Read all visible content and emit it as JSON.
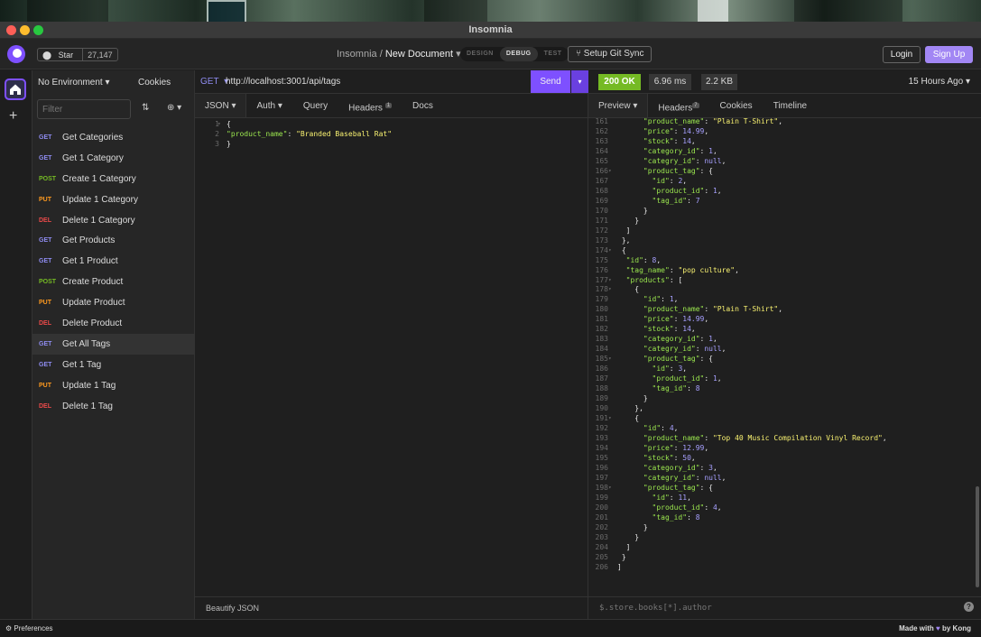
{
  "window": {
    "title": "Insomnia"
  },
  "header": {
    "github_star_label": "Star",
    "github_star_count": "27,147",
    "breadcrumb_root": "Insomnia /",
    "breadcrumb_document": "New Document",
    "modes": [
      "DESIGN",
      "DEBUG",
      "TEST"
    ],
    "active_mode": "DEBUG",
    "git_sync_label": "Setup Git Sync",
    "login_label": "Login",
    "signup_label": "Sign Up"
  },
  "sidebar": {
    "environment": "No Environment",
    "cookies_label": "Cookies",
    "filter_placeholder": "Filter",
    "requests": [
      {
        "method": "GET",
        "name": "Get Categories",
        "color": "#8f8cf1"
      },
      {
        "method": "GET",
        "name": "Get 1 Category",
        "color": "#8f8cf1"
      },
      {
        "method": "POST",
        "name": "Create 1 Category",
        "color": "#75ba24"
      },
      {
        "method": "PUT",
        "name": "Update 1 Category",
        "color": "#ff9a1f"
      },
      {
        "method": "DEL",
        "name": "Delete 1 Category",
        "color": "#ec4a4a"
      },
      {
        "method": "GET",
        "name": "Get Products",
        "color": "#8f8cf1"
      },
      {
        "method": "GET",
        "name": "Get 1 Product",
        "color": "#8f8cf1"
      },
      {
        "method": "POST",
        "name": "Create Product",
        "color": "#75ba24"
      },
      {
        "method": "PUT",
        "name": "Update Product",
        "color": "#ff9a1f"
      },
      {
        "method": "DEL",
        "name": "Delete Product",
        "color": "#ec4a4a"
      },
      {
        "method": "GET",
        "name": "Get All Tags",
        "color": "#8f8cf1",
        "selected": true
      },
      {
        "method": "GET",
        "name": "Get 1 Tag",
        "color": "#8f8cf1"
      },
      {
        "method": "PUT",
        "name": "Update 1 Tag",
        "color": "#ff9a1f"
      },
      {
        "method": "DEL",
        "name": "Delete 1 Tag",
        "color": "#ec4a4a"
      }
    ]
  },
  "request": {
    "method": "GET",
    "url": "http://localhost:3001/api/tags",
    "send_label": "Send",
    "tabs": [
      {
        "label": "JSON",
        "dropdown": true
      },
      {
        "label": "Auth",
        "dropdown": true
      },
      {
        "label": "Query"
      },
      {
        "label": "Headers",
        "badge": "1"
      },
      {
        "label": "Docs"
      }
    ],
    "body_lines": [
      {
        "n": "1",
        "fold": true,
        "parts": [
          [
            "pun",
            "{"
          ]
        ]
      },
      {
        "n": "2",
        "parts": [
          [
            "key",
            "\"product_name\""
          ],
          [
            "pun",
            ": "
          ],
          [
            "str",
            "\"Branded Baseball Rat\""
          ]
        ]
      },
      {
        "n": "3",
        "parts": [
          [
            "pun",
            "}"
          ]
        ]
      }
    ],
    "footer_label": "Beautify JSON"
  },
  "response": {
    "status": "200 OK",
    "time": "6.96 ms",
    "size": "2.2 KB",
    "when": "15 Hours Ago",
    "tabs": [
      {
        "label": "Preview",
        "dropdown": true
      },
      {
        "label": "Headers",
        "badge": "7"
      },
      {
        "label": "Cookies"
      },
      {
        "label": "Timeline"
      }
    ],
    "filter_placeholder": "$.store.books[*].author",
    "body_lines": [
      {
        "n": "161",
        "indent": 6,
        "parts": [
          [
            "key",
            "\"product_name\""
          ],
          [
            "pun",
            ": "
          ],
          [
            "str",
            "\"Plain T-Shirt\""
          ],
          [
            "pun",
            ","
          ]
        ]
      },
      {
        "n": "162",
        "indent": 6,
        "parts": [
          [
            "key",
            "\"price\""
          ],
          [
            "pun",
            ": "
          ],
          [
            "num",
            "14.99"
          ],
          [
            "pun",
            ","
          ]
        ]
      },
      {
        "n": "163",
        "indent": 6,
        "parts": [
          [
            "key",
            "\"stock\""
          ],
          [
            "pun",
            ": "
          ],
          [
            "num",
            "14"
          ],
          [
            "pun",
            ","
          ]
        ]
      },
      {
        "n": "164",
        "indent": 6,
        "parts": [
          [
            "key",
            "\"category_id\""
          ],
          [
            "pun",
            ": "
          ],
          [
            "num",
            "1"
          ],
          [
            "pun",
            ","
          ]
        ]
      },
      {
        "n": "165",
        "indent": 6,
        "parts": [
          [
            "key",
            "\"categry_id\""
          ],
          [
            "pun",
            ": "
          ],
          [
            "nul",
            "null"
          ],
          [
            "pun",
            ","
          ]
        ]
      },
      {
        "n": "166",
        "fold": true,
        "indent": 6,
        "parts": [
          [
            "key",
            "\"product_tag\""
          ],
          [
            "pun",
            ": {"
          ]
        ]
      },
      {
        "n": "167",
        "indent": 8,
        "parts": [
          [
            "key",
            "\"id\""
          ],
          [
            "pun",
            ": "
          ],
          [
            "num",
            "2"
          ],
          [
            "pun",
            ","
          ]
        ]
      },
      {
        "n": "168",
        "indent": 8,
        "parts": [
          [
            "key",
            "\"product_id\""
          ],
          [
            "pun",
            ": "
          ],
          [
            "num",
            "1"
          ],
          [
            "pun",
            ","
          ]
        ]
      },
      {
        "n": "169",
        "indent": 8,
        "parts": [
          [
            "key",
            "\"tag_id\""
          ],
          [
            "pun",
            ": "
          ],
          [
            "num",
            "7"
          ]
        ]
      },
      {
        "n": "170",
        "indent": 6,
        "parts": [
          [
            "pun",
            "}"
          ]
        ]
      },
      {
        "n": "171",
        "indent": 4,
        "parts": [
          [
            "pun",
            "}"
          ]
        ]
      },
      {
        "n": "172",
        "indent": 2,
        "parts": [
          [
            "pun",
            "]"
          ]
        ]
      },
      {
        "n": "173",
        "indent": 1,
        "parts": [
          [
            "pun",
            "},"
          ]
        ]
      },
      {
        "n": "174",
        "fold": true,
        "indent": 1,
        "parts": [
          [
            "pun",
            "{"
          ]
        ]
      },
      {
        "n": "175",
        "indent": 2,
        "parts": [
          [
            "key",
            "\"id\""
          ],
          [
            "pun",
            ": "
          ],
          [
            "num",
            "8"
          ],
          [
            "pun",
            ","
          ]
        ]
      },
      {
        "n": "176",
        "indent": 2,
        "parts": [
          [
            "key",
            "\"tag_name\""
          ],
          [
            "pun",
            ": "
          ],
          [
            "str",
            "\"pop culture\""
          ],
          [
            "pun",
            ","
          ]
        ]
      },
      {
        "n": "177",
        "fold": true,
        "indent": 2,
        "parts": [
          [
            "key",
            "\"products\""
          ],
          [
            "pun",
            ": ["
          ]
        ]
      },
      {
        "n": "178",
        "fold": true,
        "indent": 4,
        "parts": [
          [
            "pun",
            "{"
          ]
        ]
      },
      {
        "n": "179",
        "indent": 6,
        "parts": [
          [
            "key",
            "\"id\""
          ],
          [
            "pun",
            ": "
          ],
          [
            "num",
            "1"
          ],
          [
            "pun",
            ","
          ]
        ]
      },
      {
        "n": "180",
        "indent": 6,
        "parts": [
          [
            "key",
            "\"product_name\""
          ],
          [
            "pun",
            ": "
          ],
          [
            "str",
            "\"Plain T-Shirt\""
          ],
          [
            "pun",
            ","
          ]
        ]
      },
      {
        "n": "181",
        "indent": 6,
        "parts": [
          [
            "key",
            "\"price\""
          ],
          [
            "pun",
            ": "
          ],
          [
            "num",
            "14.99"
          ],
          [
            "pun",
            ","
          ]
        ]
      },
      {
        "n": "182",
        "indent": 6,
        "parts": [
          [
            "key",
            "\"stock\""
          ],
          [
            "pun",
            ": "
          ],
          [
            "num",
            "14"
          ],
          [
            "pun",
            ","
          ]
        ]
      },
      {
        "n": "183",
        "indent": 6,
        "parts": [
          [
            "key",
            "\"category_id\""
          ],
          [
            "pun",
            ": "
          ],
          [
            "num",
            "1"
          ],
          [
            "pun",
            ","
          ]
        ]
      },
      {
        "n": "184",
        "indent": 6,
        "parts": [
          [
            "key",
            "\"categry_id\""
          ],
          [
            "pun",
            ": "
          ],
          [
            "nul",
            "null"
          ],
          [
            "pun",
            ","
          ]
        ]
      },
      {
        "n": "185",
        "fold": true,
        "indent": 6,
        "parts": [
          [
            "key",
            "\"product_tag\""
          ],
          [
            "pun",
            ": {"
          ]
        ]
      },
      {
        "n": "186",
        "indent": 8,
        "parts": [
          [
            "key",
            "\"id\""
          ],
          [
            "pun",
            ": "
          ],
          [
            "num",
            "3"
          ],
          [
            "pun",
            ","
          ]
        ]
      },
      {
        "n": "187",
        "indent": 8,
        "parts": [
          [
            "key",
            "\"product_id\""
          ],
          [
            "pun",
            ": "
          ],
          [
            "num",
            "1"
          ],
          [
            "pun",
            ","
          ]
        ]
      },
      {
        "n": "188",
        "indent": 8,
        "parts": [
          [
            "key",
            "\"tag_id\""
          ],
          [
            "pun",
            ": "
          ],
          [
            "num",
            "8"
          ]
        ]
      },
      {
        "n": "189",
        "indent": 6,
        "parts": [
          [
            "pun",
            "}"
          ]
        ]
      },
      {
        "n": "190",
        "indent": 4,
        "parts": [
          [
            "pun",
            "},"
          ]
        ]
      },
      {
        "n": "191",
        "fold": true,
        "indent": 4,
        "parts": [
          [
            "pun",
            "{"
          ]
        ]
      },
      {
        "n": "192",
        "indent": 6,
        "parts": [
          [
            "key",
            "\"id\""
          ],
          [
            "pun",
            ": "
          ],
          [
            "num",
            "4"
          ],
          [
            "pun",
            ","
          ]
        ]
      },
      {
        "n": "193",
        "indent": 6,
        "parts": [
          [
            "key",
            "\"product_name\""
          ],
          [
            "pun",
            ": "
          ],
          [
            "str",
            "\"Top 40 Music Compilation Vinyl Record\""
          ],
          [
            "pun",
            ","
          ]
        ]
      },
      {
        "n": "194",
        "indent": 6,
        "parts": [
          [
            "key",
            "\"price\""
          ],
          [
            "pun",
            ": "
          ],
          [
            "num",
            "12.99"
          ],
          [
            "pun",
            ","
          ]
        ]
      },
      {
        "n": "195",
        "indent": 6,
        "parts": [
          [
            "key",
            "\"stock\""
          ],
          [
            "pun",
            ": "
          ],
          [
            "num",
            "50"
          ],
          [
            "pun",
            ","
          ]
        ]
      },
      {
        "n": "196",
        "indent": 6,
        "parts": [
          [
            "key",
            "\"category_id\""
          ],
          [
            "pun",
            ": "
          ],
          [
            "num",
            "3"
          ],
          [
            "pun",
            ","
          ]
        ]
      },
      {
        "n": "197",
        "indent": 6,
        "parts": [
          [
            "key",
            "\"categry_id\""
          ],
          [
            "pun",
            ": "
          ],
          [
            "nul",
            "null"
          ],
          [
            "pun",
            ","
          ]
        ]
      },
      {
        "n": "198",
        "fold": true,
        "indent": 6,
        "parts": [
          [
            "key",
            "\"product_tag\""
          ],
          [
            "pun",
            ": {"
          ]
        ]
      },
      {
        "n": "199",
        "indent": 8,
        "parts": [
          [
            "key",
            "\"id\""
          ],
          [
            "pun",
            ": "
          ],
          [
            "num",
            "11"
          ],
          [
            "pun",
            ","
          ]
        ]
      },
      {
        "n": "200",
        "indent": 8,
        "parts": [
          [
            "key",
            "\"product_id\""
          ],
          [
            "pun",
            ": "
          ],
          [
            "num",
            "4"
          ],
          [
            "pun",
            ","
          ]
        ]
      },
      {
        "n": "201",
        "indent": 8,
        "parts": [
          [
            "key",
            "\"tag_id\""
          ],
          [
            "pun",
            ": "
          ],
          [
            "num",
            "8"
          ]
        ]
      },
      {
        "n": "202",
        "indent": 6,
        "parts": [
          [
            "pun",
            "}"
          ]
        ]
      },
      {
        "n": "203",
        "indent": 4,
        "parts": [
          [
            "pun",
            "}"
          ]
        ]
      },
      {
        "n": "204",
        "indent": 2,
        "parts": [
          [
            "pun",
            "]"
          ]
        ]
      },
      {
        "n": "205",
        "indent": 1,
        "parts": [
          [
            "pun",
            "}"
          ]
        ]
      },
      {
        "n": "206",
        "indent": 0,
        "parts": [
          [
            "pun",
            "]"
          ]
        ]
      }
    ]
  },
  "footer": {
    "preferences_label": "Preferences",
    "made_with_prefix": "Made with",
    "made_with_suffix": "by Kong"
  },
  "colors": {
    "accent": "#7e50ff",
    "status_ok": "#75ba24",
    "signup": "#a287f4"
  }
}
